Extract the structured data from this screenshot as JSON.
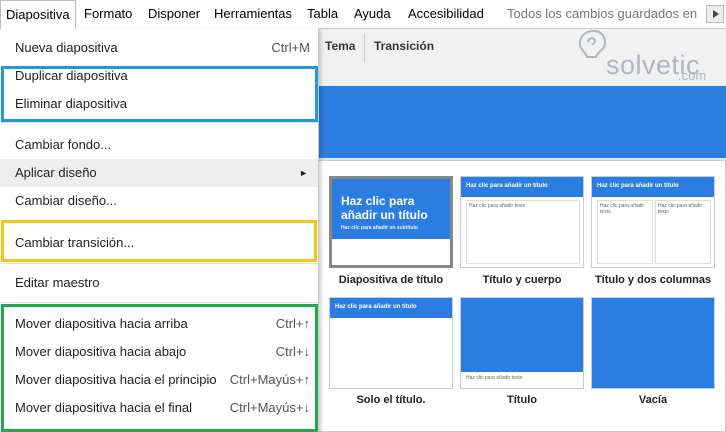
{
  "menubar": {
    "items": [
      "Diapositiva",
      "Formato",
      "Disponer",
      "Herramientas",
      "Tabla",
      "Ayuda",
      "Accesibilidad"
    ],
    "status": "Todos los cambios guardados en"
  },
  "toolbar": {
    "tab_theme": "Tema",
    "tab_transition": "Transición"
  },
  "logo": {
    "text": "solvetic",
    "suffix": ".com"
  },
  "menu": {
    "new_slide": {
      "label": "Nueva diapositiva",
      "shortcut": "Ctrl+M"
    },
    "duplicate": "Duplicar diapositiva",
    "delete": "Eliminar diapositiva",
    "change_background": "Cambiar fondo...",
    "apply_layout": "Aplicar diseño",
    "submenu_arrow": "►",
    "change_layout": "Cambiar diseño...",
    "change_transition": "Cambiar transición...",
    "edit_master": "Editar maestro",
    "move_up": {
      "label": "Mover diapositiva hacia arriba",
      "shortcut": "Ctrl+↑"
    },
    "move_down": {
      "label": "Mover diapositiva hacia abajo",
      "shortcut": "Ctrl+↓"
    },
    "move_start": {
      "label": "Mover diapositiva hacia el principio",
      "shortcut": "Ctrl+Mayús+↑"
    },
    "move_end": {
      "label": "Mover diapositiva hacia el final",
      "shortcut": "Ctrl+Mayús+↓"
    }
  },
  "highlight_colors": {
    "blue": "#1e9bd7",
    "yellow": "#f5c518",
    "green": "#23a84a",
    "accent": "#2b7de1"
  },
  "layouts": {
    "title_slide": {
      "caption": "Diapositiva de título",
      "title": "Haz clic para añadir un título",
      "subtitle": "Haz clic para añadir un subtítulo"
    },
    "title_body": {
      "caption": "Título y cuerpo",
      "title": "Haz clic para añadir un título",
      "body": "Haz clic para añadir texto"
    },
    "title_two_columns": {
      "caption": "Título y dos columnas",
      "title": "Haz clic para añadir un título",
      "body": "Haz clic para añadir texto"
    },
    "title_only": {
      "caption": "Solo el título.",
      "title": "Haz clic para añadir un título"
    },
    "title": {
      "caption": "Título",
      "body": "Haz clic para añadir texto"
    },
    "blank": {
      "caption": "Vacía"
    }
  }
}
